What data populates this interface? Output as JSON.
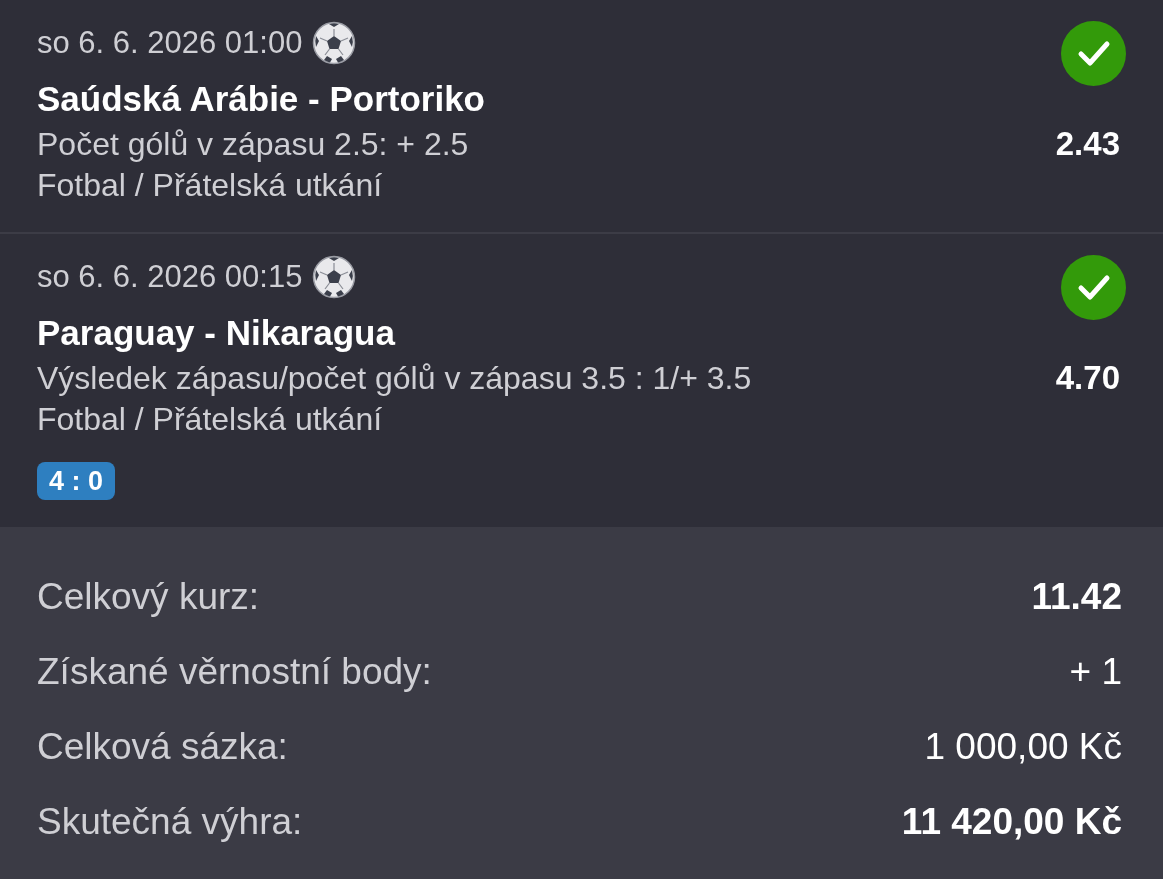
{
  "bets": [
    {
      "datetime": "so 6. 6. 2026 01:00",
      "match": "Saúdská Arábie - Portoriko",
      "market": "Počet gólů v zápasu 2.5: + 2.5",
      "category": "Fotbal / Přátelská utkání",
      "odds": "2.43",
      "won": true
    },
    {
      "datetime": "so 6. 6. 2026 00:15",
      "match": "Paraguay - Nikaragua",
      "market": "Výsledek zápasu/počet gólů v zápasu 3.5 : 1/+ 3.5",
      "category": "Fotbal / Přátelská utkání",
      "odds": "4.70",
      "won": true,
      "score": "4 : 0"
    }
  ],
  "summary": [
    {
      "label": "Celkový kurz:",
      "value": "11.42",
      "emphasized": true
    },
    {
      "label": "Získané věrnostní body:",
      "value": "+ 1",
      "emphasized": false
    },
    {
      "label": "Celková sázka:",
      "value": "1 000,00 Kč",
      "emphasized": false
    },
    {
      "label": "Skutečná výhra:",
      "value": "11 420,00 Kč",
      "emphasized": true
    }
  ]
}
